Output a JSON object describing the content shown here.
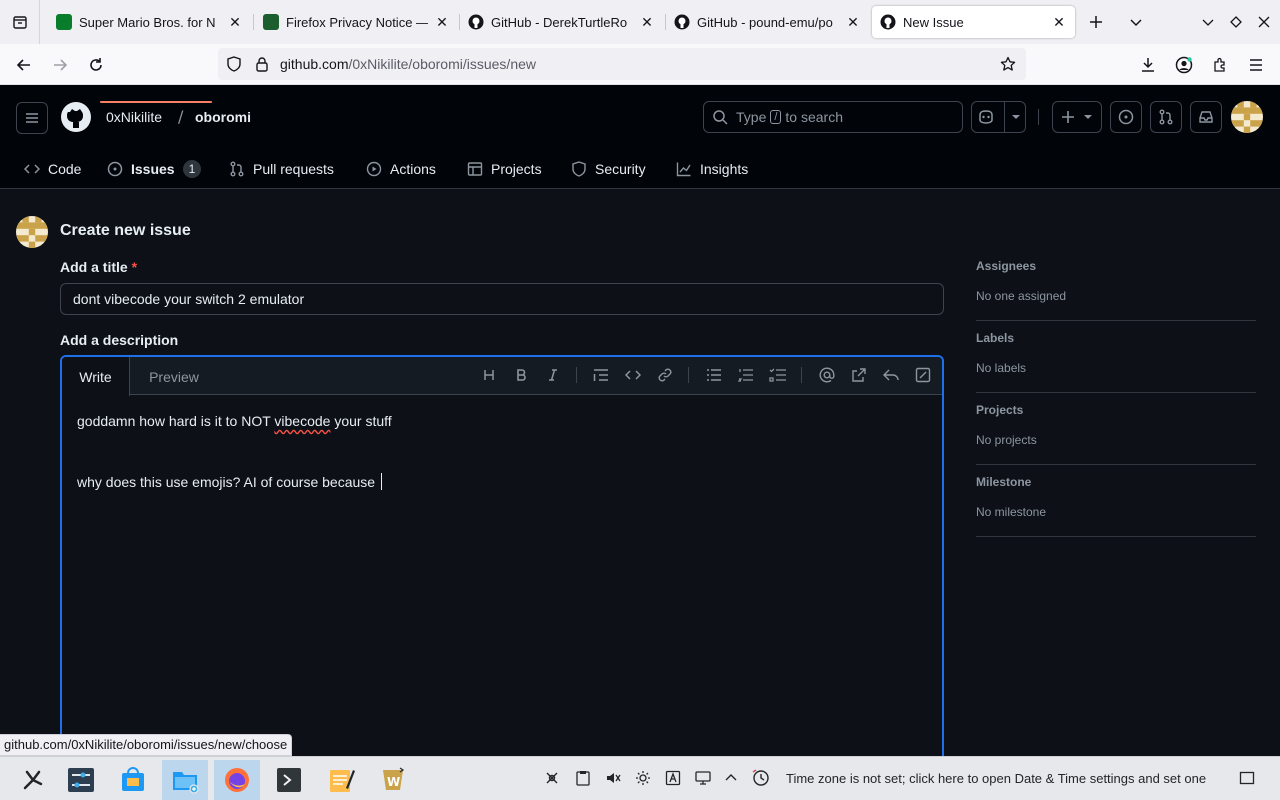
{
  "browser": {
    "tabs": [
      {
        "title": "Super Mario Bros. for N",
        "favicon_color": "#0a7d2c"
      },
      {
        "title": "Firefox Privacy Notice —",
        "favicon_color": "#1c5e2e"
      },
      {
        "title": "GitHub - DerekTurtleRo",
        "favicon_color": "#15141a"
      },
      {
        "title": "GitHub - pound-emu/po",
        "favicon_color": "#15141a"
      },
      {
        "title": "New Issue",
        "favicon_color": "#15141a"
      }
    ],
    "url_domain": "github.com",
    "url_path": "/0xNikilite/oboromi/issues/new",
    "status_url": "github.com/0xNikilite/oboromi/issues/new/choose"
  },
  "github": {
    "owner": "0xNikilite",
    "slash": "/",
    "repo": "oboromi",
    "search_type": "Type",
    "search_key": "/",
    "search_rest": "to search",
    "nav": [
      {
        "label": "Code"
      },
      {
        "label": "Issues",
        "count": "1"
      },
      {
        "label": "Pull requests"
      },
      {
        "label": "Actions"
      },
      {
        "label": "Projects"
      },
      {
        "label": "Security"
      },
      {
        "label": "Insights"
      }
    ]
  },
  "issue": {
    "heading": "Create new issue",
    "title_label": "Add a title",
    "required_mark": "*",
    "title_value": "dont vibecode your switch 2 emulator",
    "desc_label": "Add a description",
    "tab_write": "Write",
    "tab_preview": "Preview",
    "line1_a": "goddamn how hard is it to NOT ",
    "line1_b": "vibecode",
    "line1_c": " your stuff",
    "line3": "why does this use emojis? AI of course because "
  },
  "sidebar": {
    "assignees_h": "Assignees",
    "assignees_v": "No one assigned",
    "labels_h": "Labels",
    "labels_v": "No labels",
    "projects_h": "Projects",
    "projects_v": "No projects",
    "milestone_h": "Milestone",
    "milestone_v": "No milestone"
  },
  "taskbar": {
    "clock_message": "Time zone is not set; click here to open Date & Time settings and set one"
  },
  "colors": {
    "accent_border": "#1f6feb",
    "nav_underline": "#f78166",
    "bg": "#0d1117"
  }
}
